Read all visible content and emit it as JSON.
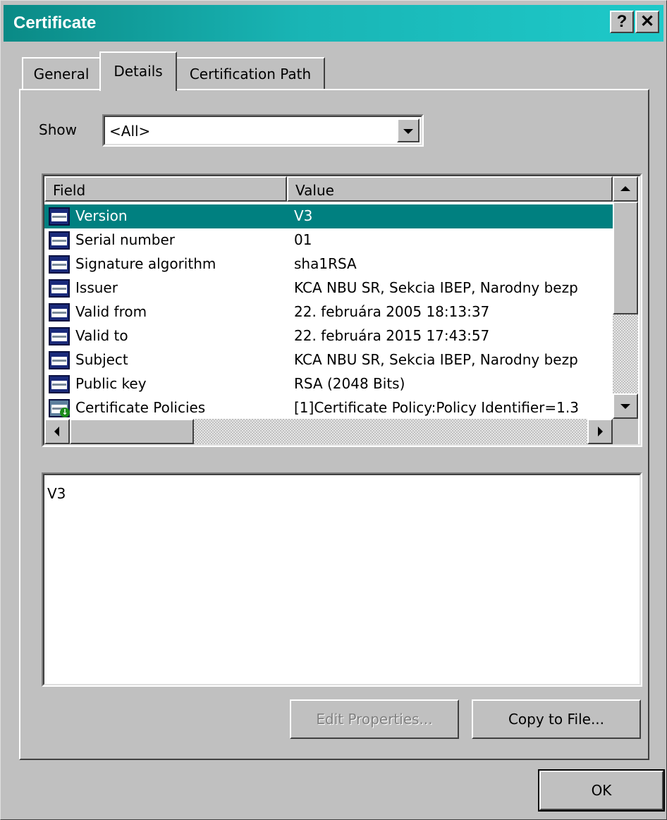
{
  "window": {
    "title": "Certificate",
    "help_label": "?",
    "close_label": "✕"
  },
  "tabs": [
    {
      "label": "General",
      "active": false
    },
    {
      "label": "Details",
      "active": true
    },
    {
      "label": "Certification Path",
      "active": false
    }
  ],
  "show": {
    "label": "Show",
    "value": "<All>"
  },
  "list": {
    "columns": [
      "Field",
      "Value"
    ],
    "rows": [
      {
        "field": "Version",
        "value": "V3",
        "icon": "certificate-field-icon",
        "selected": true
      },
      {
        "field": "Serial number",
        "value": "01",
        "icon": "certificate-field-icon",
        "selected": false
      },
      {
        "field": "Signature algorithm",
        "value": "sha1RSA",
        "icon": "certificate-field-icon",
        "selected": false
      },
      {
        "field": "Issuer",
        "value": "KCA NBU SR, Sekcia IBEP, Narodny bezp",
        "icon": "certificate-field-icon",
        "selected": false
      },
      {
        "field": "Valid from",
        "value": "22. februára 2005 18:13:37",
        "icon": "certificate-field-icon",
        "selected": false
      },
      {
        "field": "Valid to",
        "value": "22. februára 2015 17:43:57",
        "icon": "certificate-field-icon",
        "selected": false
      },
      {
        "field": "Subject",
        "value": "KCA NBU SR, Sekcia IBEP, Narodny bezp",
        "icon": "certificate-field-icon",
        "selected": false
      },
      {
        "field": "Public key",
        "value": "RSA (2048 Bits)",
        "icon": "certificate-field-icon",
        "selected": false
      },
      {
        "field": "Certificate Policies",
        "value": "[1]Certificate Policy:Policy Identifier=1.3",
        "icon": "certificate-extension-icon",
        "selected": false
      }
    ]
  },
  "detail_text": "V3",
  "buttons": {
    "edit_properties": "Edit Properties...",
    "copy_to_file": "Copy to File...",
    "ok": "OK"
  },
  "colors": {
    "title_bar": "#0a8a86",
    "selection": "#008080",
    "face": "#c0c0c0"
  }
}
